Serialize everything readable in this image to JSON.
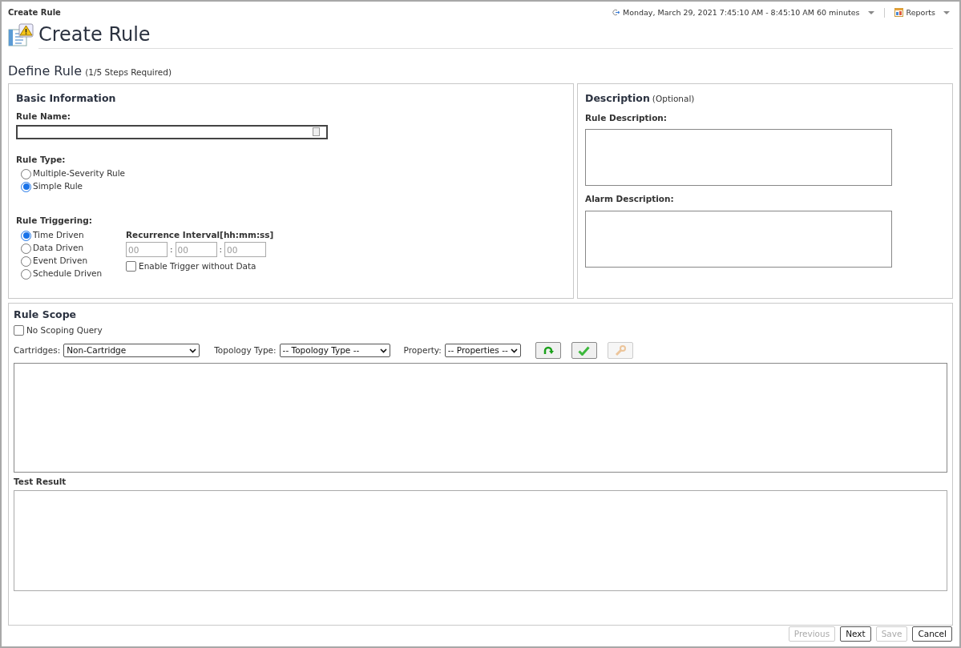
{
  "window": {
    "title": "Create Rule"
  },
  "time_range": "Monday, March 29, 2021 7:45:10 AM - 8:45:10 AM 60 minutes",
  "reports_menu": "Reports",
  "page_title": "Create Rule",
  "section": {
    "title": "Define Rule",
    "note": "(1/5 Steps Required)"
  },
  "basic_information": {
    "title": "Basic Information",
    "rule_name": {
      "label": "Rule Name:"
    },
    "rule_type": {
      "label": "Rule Type:",
      "options": [
        {
          "label": "Multiple-Severity Rule",
          "selected": false
        },
        {
          "label": "Simple Rule",
          "selected": true
        }
      ]
    },
    "rule_triggering": {
      "label": "Rule Triggering:",
      "options": [
        {
          "label": "Time Driven",
          "selected": true
        },
        {
          "label": "Data Driven",
          "selected": false
        },
        {
          "label": "Event Driven",
          "selected": false
        },
        {
          "label": "Schedule Driven",
          "selected": false
        }
      ]
    },
    "recurrence_interval": {
      "label": "Recurrence Interval[hh:mm:ss]",
      "separator": ":",
      "fields": [
        {
          "placeholder": "00"
        },
        {
          "placeholder": "00"
        },
        {
          "placeholder": "00"
        }
      ]
    },
    "enable_trigger_without_data": {
      "label": "Enable Trigger without Data",
      "checked": false
    }
  },
  "description": {
    "title": "Description",
    "note": "(Optional)",
    "fields": [
      {
        "label": "Rule Description:"
      },
      {
        "label": "Alarm Description:"
      }
    ]
  },
  "rule_scope": {
    "title": "Rule Scope",
    "no_scoping_query": {
      "label": "No Scoping Query",
      "checked": false
    },
    "filters": [
      {
        "label": "Cartridges:",
        "value": "Non-Cartridge"
      },
      {
        "label": "Topology Type:",
        "value": "-- Topology Type --"
      },
      {
        "label": "Property:",
        "value": "-- Properties --"
      }
    ],
    "tool_buttons": [
      {
        "kind": "refresh",
        "disabled": false
      },
      {
        "kind": "check",
        "disabled": false
      },
      {
        "kind": "wrench",
        "disabled": true
      }
    ],
    "test_result_label": "Test Result"
  },
  "buttons": [
    {
      "label": "Previous",
      "disabled": true
    },
    {
      "label": "Next",
      "disabled": false
    },
    {
      "label": "Save",
      "disabled": true
    },
    {
      "label": "Cancel",
      "disabled": false
    }
  ]
}
